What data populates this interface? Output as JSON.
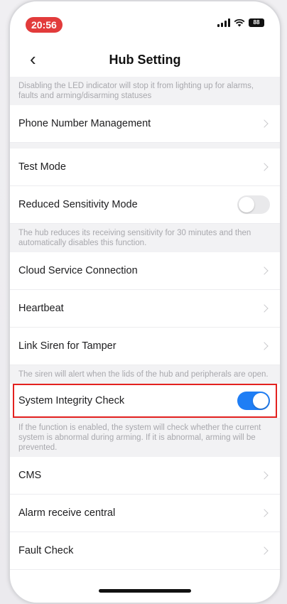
{
  "status_bar": {
    "time": "20:56",
    "battery": "88"
  },
  "nav": {
    "back_glyph": "‹",
    "title": "Hub Setting"
  },
  "descriptions": {
    "led": "Disabling the LED indicator will stop it from lighting up for alarms, faults and arming/disarming statuses",
    "sensitivity": "The hub reduces its receiving sensitivity for 30 minutes and then automatically disables this function.",
    "tamper": "The siren will alert when the lids of the hub and peripherals are open.",
    "integrity": "If the function is enabled, the system will check whether the current system is abnormal during arming. If it is abnormal, arming will be prevented."
  },
  "rows": {
    "phone_number": "Phone Number Management",
    "test_mode": "Test Mode",
    "reduced_sensitivity": "Reduced Sensitivity Mode",
    "cloud_service": "Cloud Service Connection",
    "heartbeat": "Heartbeat",
    "link_siren": "Link Siren for Tamper",
    "system_integrity": "System Integrity Check",
    "cms": "CMS",
    "alarm_receive": "Alarm receive central",
    "fault_check": "Fault Check"
  },
  "toggles": {
    "reduced_sensitivity": false,
    "system_integrity": true
  },
  "colors": {
    "time_pill": "#e23b3b",
    "toggle_on": "#1f7ef5",
    "highlight": "#e3211f"
  }
}
